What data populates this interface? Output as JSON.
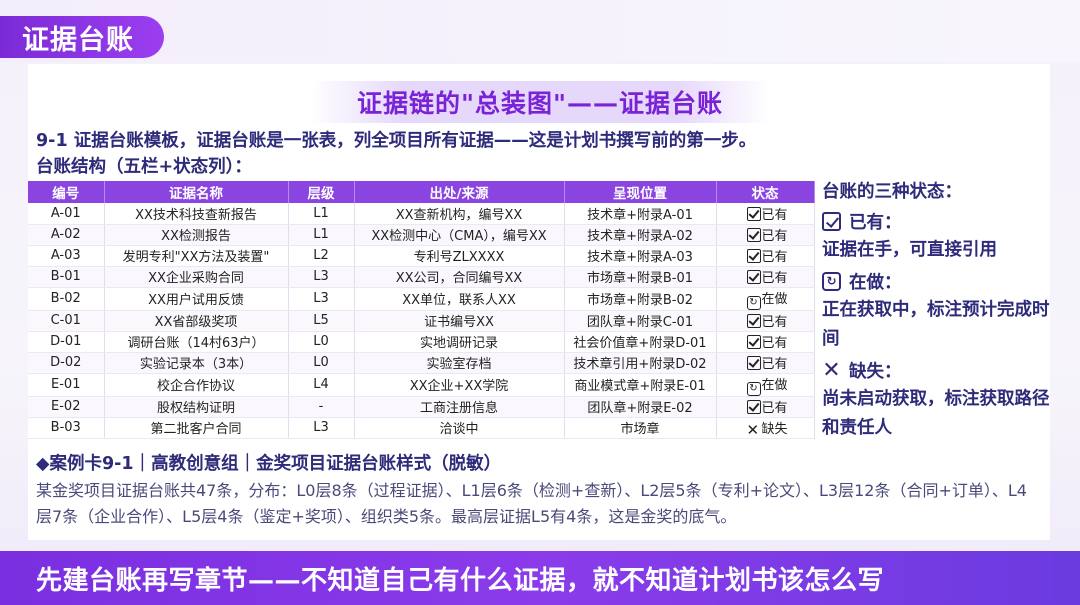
{
  "page": {
    "title": "证据台账"
  },
  "heading": "证据链的\"总装图\"——证据台账",
  "intro": "9-1 证据台账模板，证据台账是一张表，列全项目所有证据——这是计划书撰写前的第一步。",
  "structure": "台账结构（五栏+状态列）：",
  "table": {
    "columns": [
      "编号",
      "证据名称",
      "层级",
      "出处/来源",
      "呈现位置",
      "状态"
    ],
    "rows": [
      {
        "id": "A-01",
        "name": "XX技术科技查新报告",
        "level": "L1",
        "source": "XX查新机构，编号XX",
        "location": "技术章+附录A-01",
        "status": "已有",
        "status_icon": "checkbox-icon"
      },
      {
        "id": "A-02",
        "name": "XX检测报告",
        "level": "L1",
        "source": "XX检测中心（CMA），编号XX",
        "location": "技术章+附录A-02",
        "status": "已有",
        "status_icon": "checkbox-icon"
      },
      {
        "id": "A-03",
        "name": "发明专利\"XX方法及装置\"",
        "level": "L2",
        "source": "专利号ZLXXXX",
        "location": "技术章+附录A-03",
        "status": "已有",
        "status_icon": "checkbox-icon"
      },
      {
        "id": "B-01",
        "name": "XX企业采购合同",
        "level": "L3",
        "source": "XX公司，合同编号XX",
        "location": "市场章+附录B-01",
        "status": "已有",
        "status_icon": "checkbox-icon"
      },
      {
        "id": "B-02",
        "name": "XX用户试用反馈",
        "level": "L3",
        "source": "XX单位，联系人XX",
        "location": "市场章+附录B-02",
        "status": "在做",
        "status_icon": "refresh-icon"
      },
      {
        "id": "C-01",
        "name": "XX省部级奖项",
        "level": "L5",
        "source": "证书编号XX",
        "location": "团队章+附录C-01",
        "status": "已有",
        "status_icon": "checkbox-icon"
      },
      {
        "id": "D-01",
        "name": "调研台账（14村63户）",
        "level": "L0",
        "source": "实地调研记录",
        "location": "社会价值章+附录D-01",
        "status": "已有",
        "status_icon": "checkbox-icon"
      },
      {
        "id": "D-02",
        "name": "实验记录本（3本）",
        "level": "L0",
        "source": "实验室存档",
        "location": "技术章引用+附录D-02",
        "status": "已有",
        "status_icon": "checkbox-icon"
      },
      {
        "id": "E-01",
        "name": "校企合作协议",
        "level": "L4",
        "source": "XX企业+XX学院",
        "location": "商业模式章+附录E-01",
        "status": "在做",
        "status_icon": "refresh-icon"
      },
      {
        "id": "E-02",
        "name": "股权结构证明",
        "level": "-",
        "source": "工商注册信息",
        "location": "团队章+附录E-02",
        "status": "已有",
        "status_icon": "checkbox-icon"
      },
      {
        "id": "B-03",
        "name": "第二批客户合同",
        "level": "L3",
        "source": "洽谈中",
        "location": "市场章",
        "status": "缺失",
        "status_icon": "cross-icon"
      }
    ]
  },
  "side": {
    "title": "台账的三种状态：",
    "states": [
      {
        "icon": "checkbox-icon",
        "label": "已有：",
        "desc": "证据在手，可直接引用"
      },
      {
        "icon": "refresh-icon",
        "label": "在做：",
        "desc": "正在获取中，标注预计完成时间"
      },
      {
        "icon": "cross-icon",
        "label": "缺失：",
        "desc": "尚未启动获取，标注获取路径和责任人"
      }
    ]
  },
  "case": {
    "title": "◆案例卡9-1｜高教创意组｜金奖项目证据台账样式（脱敏）",
    "body": "某金奖项目证据台账共47条，分布：L0层8条（过程证据）、L1层6条（检测+查新）、L2层5条（专利+论文）、L3层12条（合同+订单）、L4层7条（企业合作）、L5层4条（鉴定+奖项）、组织类5条。最高层证据L5有4条，这是金奖的底气。"
  },
  "footer": "先建台账再写章节——不知道自己有什么证据，就不知道计划书该怎么写",
  "colors": {
    "accent": "#8a45e0",
    "text_dark": "#2e2b7a",
    "heading": "#7a22d6"
  }
}
